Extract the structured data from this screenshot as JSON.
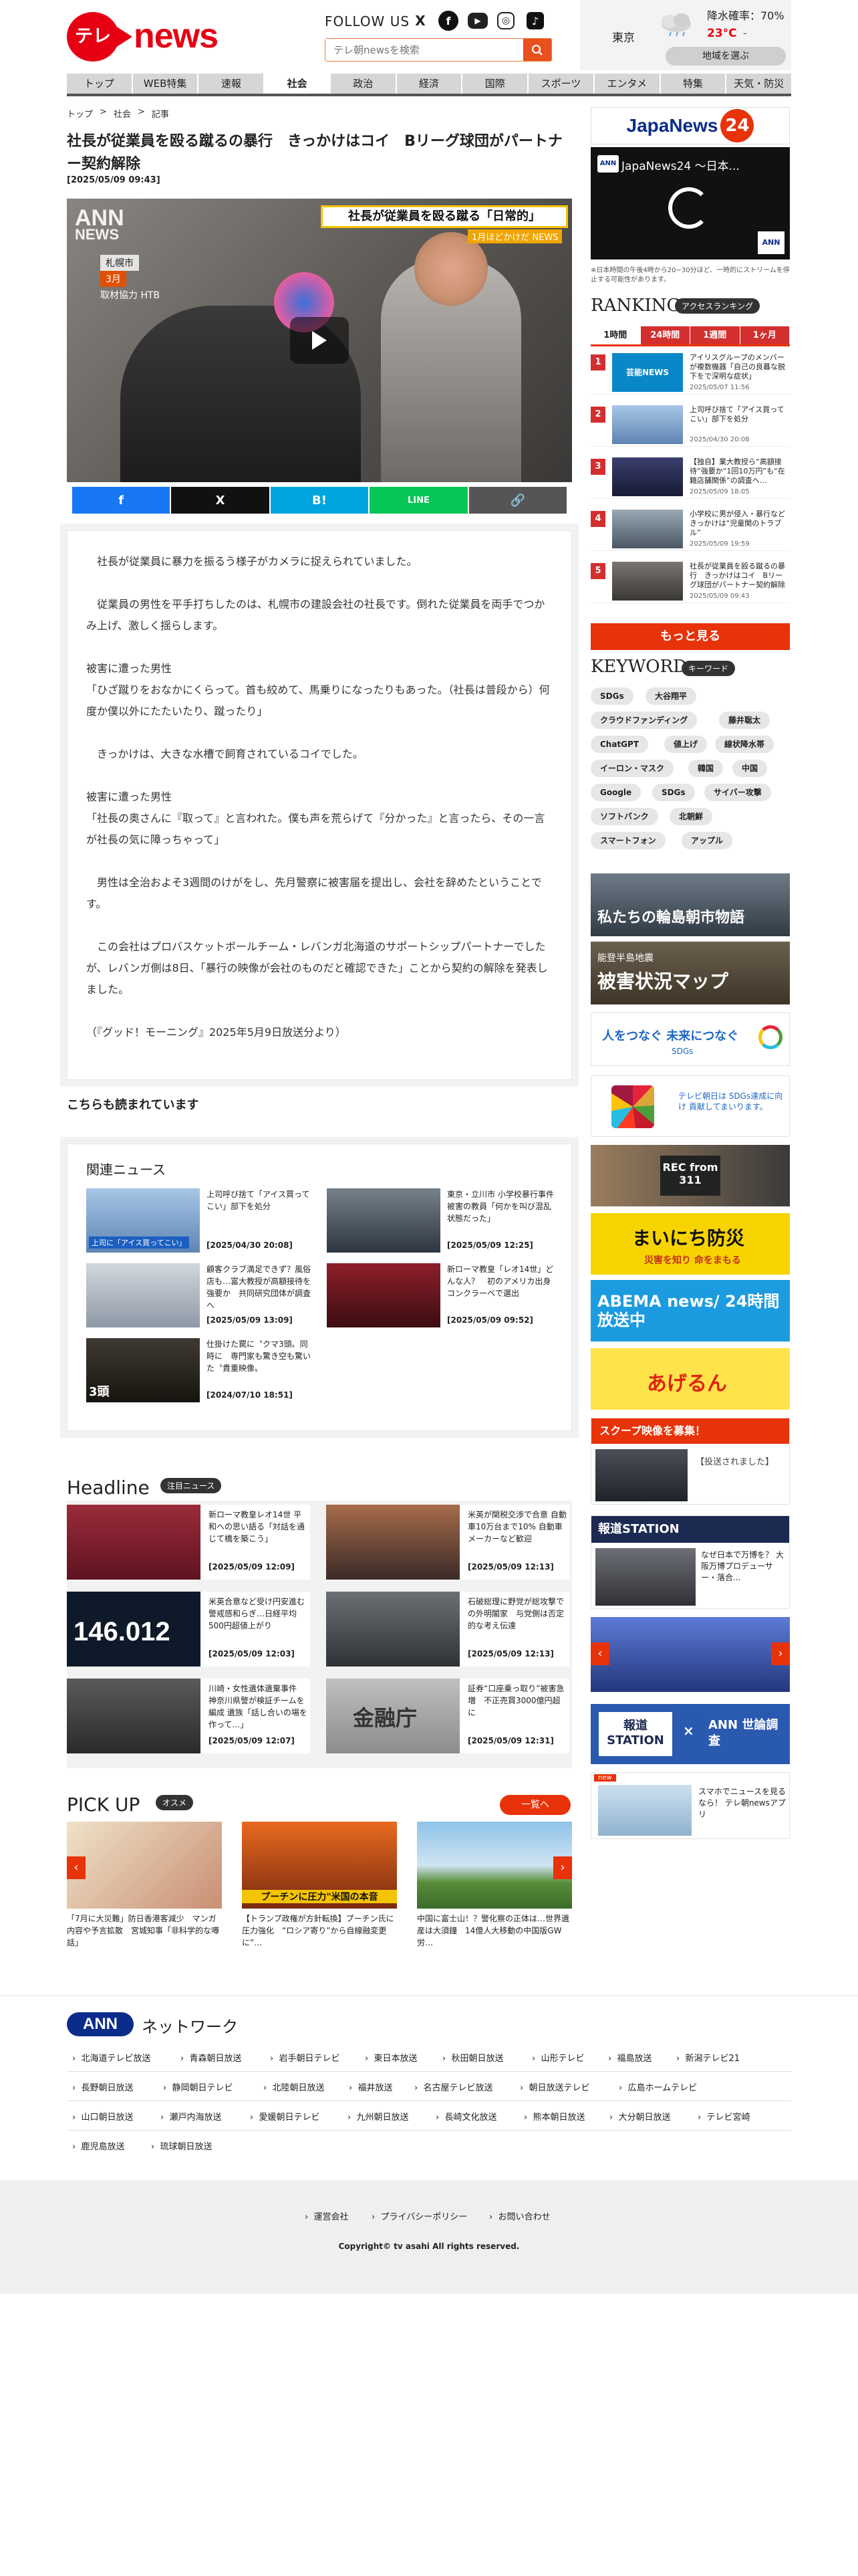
{
  "header": {
    "logo_tv": "テレ朝",
    "logo_news": "news",
    "follow_us": "FOLLOW US",
    "social": [
      "X",
      "f",
      "▶",
      "◎",
      "♪"
    ],
    "search_placeholder": "テレ朝newsを検索",
    "weather": {
      "city": "東京",
      "rain": "降水確率：70%",
      "temp": "23°C",
      "temp_sep": "-",
      "region_button": "地域を選ぶ"
    }
  },
  "nav": [
    "トップ",
    "WEB特集",
    "速報",
    "社会",
    "政治",
    "経済",
    "国際",
    "スポーツ",
    "エンタメ",
    "特集",
    "天気・防災"
  ],
  "nav_active": "社会",
  "breadcrumb": [
    "トップ",
    ">",
    "社会",
    ">",
    "記事"
  ],
  "article": {
    "title": "社長が従業員を殴る蹴るの暴行　きっかけはコイ　Bリーグ球団がパートナー契約解除",
    "date": "[2025/05/09 09:43]",
    "video": {
      "ann": "ANN",
      "ann_sub": "NEWS",
      "caption": "社長が従業員を殴る蹴る「日常的」",
      "subcaption": "1月ほどかけだ NEWS",
      "city": "札幌市",
      "month": "3月",
      "credit": "取材協力 HTB"
    },
    "share": [
      "f",
      "X",
      "B!",
      "LINE",
      "🔗"
    ],
    "paragraphs": [
      "社長が従業員に暴力を振るう様子がカメラに捉えられていました。",
      "従業員の男性を平手打ちしたのは、札幌市の建設会社の社長です。倒れた従業員を両手でつかみ上げ、激しく揺らします。",
      "被害に遭った男性\n「ひざ蹴りをおなかにくらって。首も絞めて、馬乗りになったりもあった。（社長は普段から）何度か僕以外にたたいたり、蹴ったり」",
      "きっかけは、大きな水槽で飼育されているコイでした。",
      "被害に遭った男性\n「社長の奥さんに『取って』と言われた。僕も声を荒らげて『分かった』と言ったら、その一言が社長の気に障っちゃって」",
      "男性は全治およそ3週間のけがをし、先月警察に被害届を提出し、会社を辞めたということです。",
      "この会社はプロバスケットボールチーム・レバンガ北海道のサポートシップパートナーでしたが、レバンガ側は8日、「暴行の映像が会社のものだと確認できた」ことから契約の解除を発表しました。",
      "（『グッド！モーニング』2025年5月9日放送分より）"
    ]
  },
  "also_read": "こちらも読まれています",
  "related": {
    "title": "関連ニュース",
    "items": [
      {
        "text": "上司呼び捨て「アイス買ってこい」部下を処分",
        "date": "[2025/04/30 20:08]",
        "thumb_label": "上司に「アイス買ってこい」"
      },
      {
        "text": "東京・立川市 小学校暴行事件　被害の教員「何かを叫び混乱状態だった」",
        "date": "[2025/05/09 12:25]",
        "thumb_label": ""
      },
      {
        "text": "顧客クラブ満足できず？風俗店も…富大教授が高額接待を強要か　共同研究団体が調査へ",
        "date": "[2025/05/09 13:09]",
        "thumb_label": ""
      },
      {
        "text": "新ローマ教皇「レオ14世」どんな人？　初のアメリカ出身　コンクラーベで選出",
        "date": "[2025/05/09 09:52]",
        "thumb_label": ""
      },
      {
        "text": "仕掛けた罠に〝クマ3頭〟同時に　専門家も驚き空も驚いた〝貴重映像〟",
        "date": "[2024/07/10 18:51]",
        "thumb_label": "3頭"
      }
    ]
  },
  "headline": {
    "title": "Headline",
    "badge": "注目ニュース",
    "items": [
      {
        "text": "新ローマ教皇レオ14世 平和への思い語る「対話を通じて橋を築こう」",
        "date": "[2025/05/09 12:09]",
        "thumb_label": ""
      },
      {
        "text": "米英が関税交渉で合意 自動車10万台まで10% 自動車メーカーなど歓迎",
        "date": "[2025/05/09 12:13]",
        "thumb_label": ""
      },
      {
        "text": "米英合意など受け円安進む　警戒感和らぎ…日経平均500円超値上がり",
        "date": "[2025/05/09 12:03]",
        "thumb_label": "146.012"
      },
      {
        "text": "石破総理に野党が総攻撃での外明閣家　与党側は否定的な考え伝達",
        "date": "[2025/05/09 12:13]",
        "thumb_label": ""
      },
      {
        "text": "川崎・女性遺体遺棄事件　神奈川県警が検証チームを編成 遺族「話し合いの場を作って…」",
        "date": "[2025/05/09 12:07]",
        "thumb_label": ""
      },
      {
        "text": "証券“口座乗っ取り”被害急増　不正売買3000億円超に",
        "date": "[2025/05/09 12:31]",
        "thumb_label": "金融庁"
      }
    ]
  },
  "pickup": {
    "title": "PICK UP",
    "badge": "オスメ",
    "more": "一覧へ",
    "items": [
      {
        "text": "「7月に大災難」防日香港客減少　マンガ内容や予言拡散　宮城知事「非科学的な噂話」",
        "thumb_label": ""
      },
      {
        "text": "【トランプ政権が方針転換】プーチン氏に圧力強化　“ロシア寄り”から自線融変更に”…",
        "thumb_label": "プーチンに圧力\"米国の本音"
      },
      {
        "text": "中国に富士山！？警化察の正体は…世界遺産は大須鐘　14億人大移動の中国版GW労…",
        "thumb_label": ""
      }
    ]
  },
  "network": {
    "logo": "ANN",
    "label": "ネットワーク",
    "rows": [
      [
        "北海道テレビ放送",
        "青森朝日放送",
        "岩手朝日テレビ",
        "東日本放送",
        "秋田朝日放送",
        "山形テレビ",
        "福島放送",
        "新潟テレビ21"
      ],
      [
        "長野朝日放送",
        "静岡朝日テレビ",
        "北陸朝日放送",
        "福井放送",
        "名古屋テレビ放送",
        "朝日放送テレビ",
        "広島ホームテレビ"
      ],
      [
        "山口朝日放送",
        "瀬戸内海放送",
        "愛媛朝日テレビ",
        "九州朝日放送",
        "長崎文化放送",
        "熊本朝日放送",
        "大分朝日放送",
        "テレビ宮崎"
      ],
      [
        "鹿児島放送",
        "琉球朝日放送"
      ]
    ]
  },
  "footer": {
    "links": [
      "運営会社",
      "プライバシーポリシー",
      "お問い合わせ"
    ],
    "copyright": "Copyright© tv asahi All rights reserved."
  },
  "sidebar": {
    "jn24": {
      "name": "JapaNews",
      "num": "24",
      "video_title": "JapaNews24 ～日本...",
      "ann": "ANN",
      "note": "※日本時間の午後4時から20~30分ほど、一時的にストリームを停止する可能性があります。"
    },
    "ranking": {
      "title": "RANKING",
      "badge": "アクセスランキング",
      "tabs": [
        "1時間",
        "24時間",
        "1週間",
        "1ヶ月"
      ],
      "active_tab": "1時間",
      "more": "もっと見る",
      "items": [
        {
          "num": "1",
          "text": "アイリスグループのメンバーが複数機器「自己の良暮な脱下をで深明な症状」",
          "date": "2025/05/07 11:56",
          "thumb_label": "芸能NEWS"
        },
        {
          "num": "2",
          "text": "上司呼び捨て「アイス買ってこい」部下を処分",
          "date": "2025/04/30 20:08",
          "thumb_label": ""
        },
        {
          "num": "3",
          "text": "【独自】業大教授ら“高額接待”強要か“1回10万円”も“在籍店舗関係”の調査へ…",
          "date": "2025/05/09 18:05",
          "thumb_label": ""
        },
        {
          "num": "4",
          "text": "小学校に男が侵入・暴行など　きっかけは“児童関のトラブル”",
          "date": "2025/05/09 19:59",
          "thumb_label": ""
        },
        {
          "num": "5",
          "text": "社長が従業員を殴る蹴るの暴行　きっかけはコイ　Bリーグ球団がパートナー契約解除",
          "date": "2025/05/09 09:43",
          "thumb_label": ""
        }
      ]
    },
    "keyword": {
      "title": "KEYWORD",
      "badge": "キーワード",
      "items": [
        "SDGs",
        "大谷翔平",
        "クラウドファンディング",
        "藤井聡太",
        "ChatGPT",
        "値上げ",
        "線状降水帯",
        "イーロン・マスク",
        "韓国",
        "中国",
        "Google",
        "SDGs",
        "サイバー攻撃",
        "ソフトバンク",
        "北朝鮮",
        "スマートフォン",
        "アップル"
      ]
    },
    "banners": {
      "wajima": "私たちの輪島朝市物語",
      "noto": "能登半島地震",
      "noto_map": "被害状況マップ",
      "sdgs_main": "人をつなぐ 未来につなぐ",
      "sdgs_sub": "SDGs",
      "sdgs2": "テレビ朝日は SDGs達成に向け 貢献してまいります。",
      "rec": "REC from 311",
      "mainichi": "まいにち防災",
      "mainichi_sub": "災害を知り 命をまもる",
      "abema": "ABEMA news/ 24時間放送中",
      "aderun": "あげるん",
      "scoop_top": "スクープ映像を募集！",
      "scoop_text": "【投送されました】",
      "houdou": "報道STATION",
      "houdou_text": "なぜ日本で万博を？ 大阪万博プロデューサー・落合...",
      "houdou2": "報道 STATION",
      "poll": "ANN 世論調査",
      "app_text": "スマホでニュースを見るなら！ テレ朝newsアプリ",
      "app_new": "new"
    }
  },
  "colors": {
    "brand": "#e60012",
    "accent": "#e8320a",
    "facebook": "#1877f2",
    "x": "#111111",
    "hatena": "#00a4de",
    "line": "#06c755",
    "copy": "#555555"
  }
}
